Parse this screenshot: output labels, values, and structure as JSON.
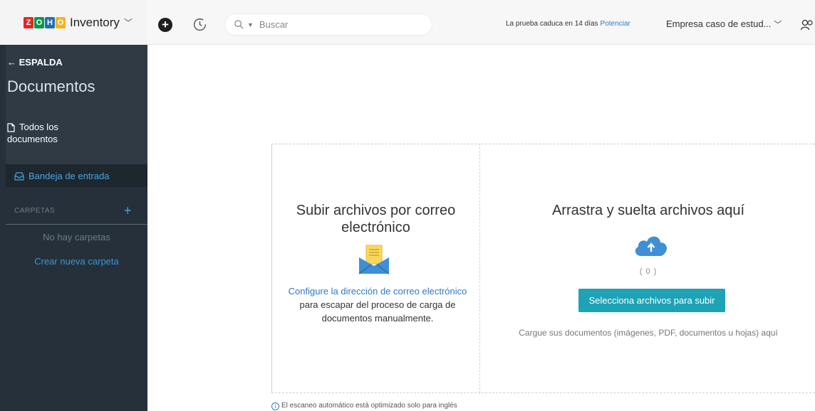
{
  "header": {
    "logo_letters": [
      "Z",
      "O",
      "H",
      "O"
    ],
    "app_name": "Inventory",
    "search_placeholder": "Buscar",
    "trial_text": "La prueba caduca en 14 días",
    "upgrade_link": "Potenciar",
    "org_name": "Empresa caso de estud...",
    "icons": {
      "app_switch": "chevron-down-icon",
      "create": "plus-circle-icon",
      "history": "history-icon",
      "search": "search-icon",
      "user": "user-icon"
    }
  },
  "sidebar": {
    "back_label": "← ESPALDA",
    "title": "Documentos",
    "all_docs_label": "Todos los documentos",
    "inbox_label": "Bandeja de entrada",
    "folders_header": "CARPETAS",
    "folders_add": "+",
    "no_folders_text": "No hay carpetas",
    "new_folder_link": "Crear nueva carpeta"
  },
  "main": {
    "mail_title": "Subir archivos por correo electrónico",
    "mail_link": "Configure la dirección de correo electrónico",
    "mail_desc": " para escapar del proceso de carga de documentos manualmente.",
    "drop_title": "Arrastra y suelta archivos aquí",
    "count": "( 0 )",
    "select_button": "Selecciona archivos para subir",
    "upload_hint": "Cargue sus documentos (imágenes, PDF, documentos u hojas) aquí",
    "scan_note": "El escaneo automático está optimizado solo para inglés"
  },
  "colors": {
    "sidebar_bg": "#26303a",
    "accent_blue": "#46a8e3",
    "button_teal": "#1ea2b5",
    "link_blue": "#2c7ac7"
  }
}
